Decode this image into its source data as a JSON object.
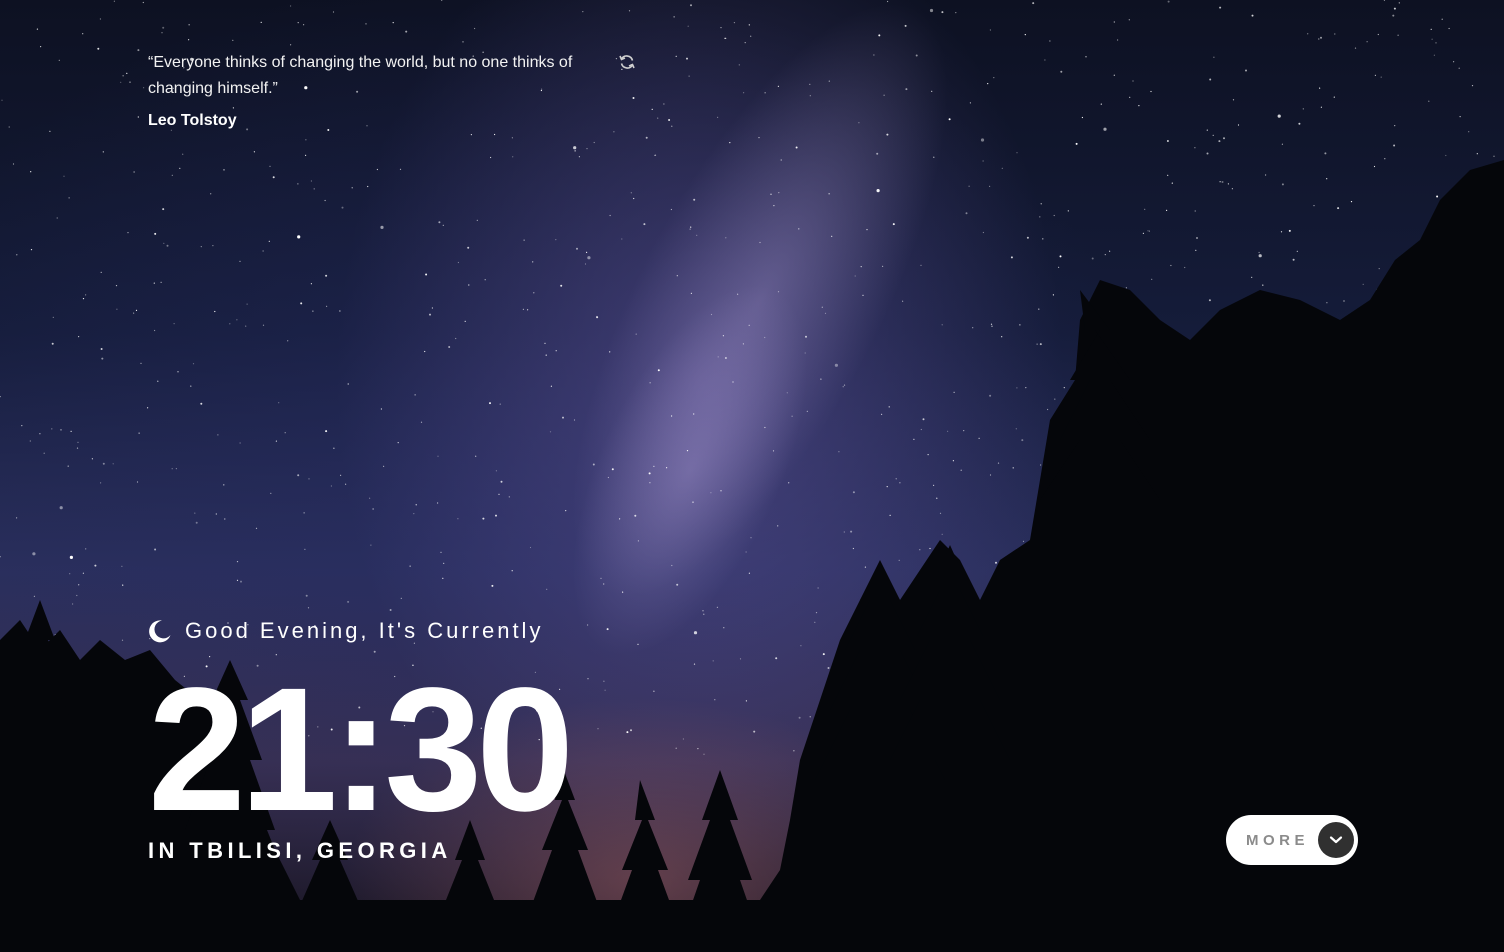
{
  "quote": {
    "text": "“Everyone thinks of changing the world, but no one thinks of changing himself.”",
    "author": "Leo Tolstoy"
  },
  "greeting": {
    "text": "Good Evening, It's Currently"
  },
  "clock": {
    "time": "21:30",
    "location": "IN TBILISI, GEORGIA"
  },
  "more_button": {
    "label": "MORE"
  },
  "colors": {
    "text": "#ffffff",
    "button_bg": "#ffffff",
    "button_label": "#8b8b8b",
    "button_arrow_bg": "#303030"
  },
  "icons": {
    "refresh": "refresh-icon",
    "moon": "moon-icon",
    "chevron": "chevron-down-icon"
  }
}
